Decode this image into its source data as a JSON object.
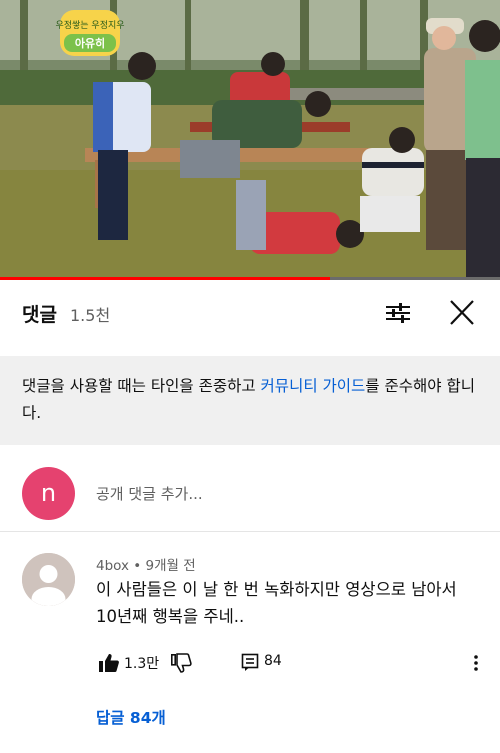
{
  "video": {
    "overlay_badge_line1": "우정쌓는 우정지우",
    "overlay_badge_line2": "아유히",
    "progress_fraction": 0.66
  },
  "comments_header": {
    "title": "댓글",
    "count": "1.5천",
    "sort_icon": "sort-sliders-icon",
    "close_icon": "close-icon"
  },
  "guidelines": {
    "text_before": "댓글을 사용할 때는 타인을 존중하고 ",
    "link": "커뮤니티 가이드",
    "text_after": "를 준수해야 합니다."
  },
  "add_comment": {
    "avatar_letter": "n",
    "avatar_color": "#e5426f",
    "placeholder": "공개 댓글 추가..."
  },
  "comment": {
    "author": "4box",
    "separator": " • ",
    "time": "9개월 전",
    "line1": "이 사람들은 이 날 한 번 녹화하지만  영상으로 남아서",
    "line2": "10년째 행복을 주네..",
    "likes": "1.3만",
    "replies_count": "84",
    "replies_link": "답글 84개"
  },
  "colors": {
    "link": "#065fd4",
    "progress": "#ff0000",
    "guide_bg": "#f0f0f0"
  }
}
